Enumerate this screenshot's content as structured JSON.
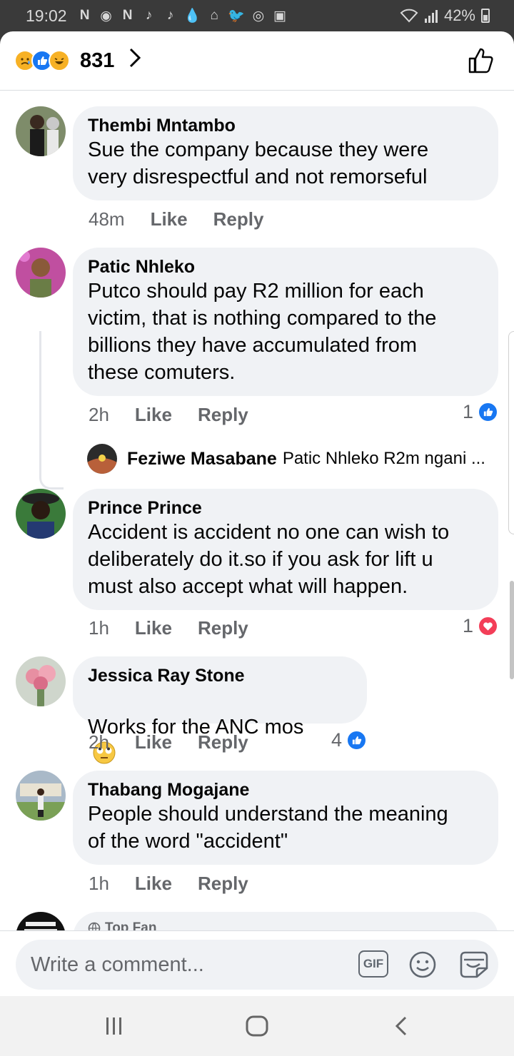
{
  "status_bar": {
    "time": "19:02",
    "battery": "42%",
    "notification_icons": [
      "N",
      "◉",
      "N",
      "♪",
      "♪",
      "💧",
      "⌂",
      "🐦",
      "◎",
      "▣"
    ]
  },
  "header": {
    "reaction_count": "831"
  },
  "comments": [
    {
      "name": "Thembi Mntambo",
      "text": "Sue the company because they were\nvery disrespectful and not remorseful",
      "time": "48m",
      "like": "Like",
      "reply": "Reply"
    },
    {
      "name": "Patic Nhleko",
      "text": "Putco should pay R2 million for each\nvictim, that is nothing compared to the\nbillions they have accumulated from\nthese comuters.",
      "time": "2h",
      "like": "Like",
      "reply": "Reply",
      "reaction_count": "1"
    },
    {
      "name": "Prince Prince",
      "text": "Accident is accident no one can wish to\ndeliberately do it.so if you ask for lift u\nmust also accept what will happen.",
      "time": "1h",
      "like": "Like",
      "reply": "Reply",
      "reaction_count": "1"
    },
    {
      "name": "Jessica Ray Stone",
      "text": "Works for the ANC mos",
      "time": "2h",
      "like": "Like",
      "reply": "Reply",
      "reaction_count": "4"
    },
    {
      "name": "Thabang Mogajane",
      "text": "People should understand the meaning\nof the word \"accident\"",
      "time": "1h",
      "like": "Like",
      "reply": "Reply"
    }
  ],
  "reply_preview": {
    "name": "Feziwe Masabane",
    "text": "Patic Nhleko R2m ngani ..."
  },
  "partial_comment": {
    "badge": "Top Fan"
  },
  "composer": {
    "placeholder": "Write a comment...",
    "gif_label": "GIF"
  },
  "colors": {
    "accent": "#1877f2",
    "bubble": "#f0f2f5",
    "meta_text": "#65676b",
    "love": "#f33e58"
  }
}
